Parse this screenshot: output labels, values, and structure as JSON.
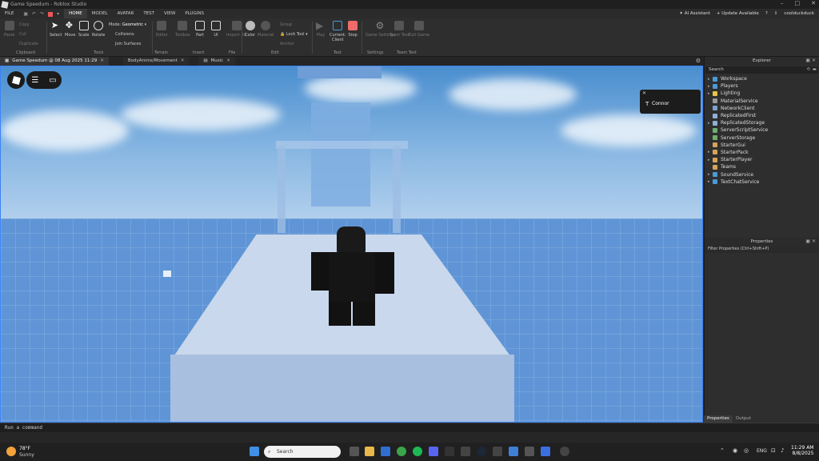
{
  "window": {
    "title": "Game Speedum - Roblox Studio"
  },
  "menu": {
    "items": [
      "FILE",
      "HOME",
      "MODEL",
      "AVATAR",
      "TEST",
      "VIEW",
      "PLUGINS"
    ],
    "ai_assistant": "AI Assistant",
    "update": "Update Available",
    "username": "coolduckduck"
  },
  "ribbon": {
    "clipboard": {
      "paste": "Paste",
      "copy": "Copy",
      "cut": "Cut",
      "duplicate": "Duplicate",
      "group": "Clipboard"
    },
    "tools": {
      "select": "Select",
      "move": "Move",
      "scale": "Scale",
      "rotate": "Rotate",
      "mode_label": "Mode:",
      "mode_value": "Geometric",
      "collisions": "Collisions",
      "join": "Join Surfaces",
      "group": "Tools"
    },
    "terrain": {
      "editor": "Editor",
      "toolbox": "Toolbox",
      "group": "Terrain"
    },
    "insert": {
      "part": "Part",
      "ui": "UI",
      "group": "Insert"
    },
    "file": {
      "import": "Import 3D",
      "group": "File"
    },
    "edit": {
      "color": "Color",
      "material": "Material",
      "group_btn": "Group",
      "lock": "Lock Tool",
      "anchor": "Anchor",
      "group": "Edit"
    },
    "test": {
      "play": "Play",
      "current": "Current:",
      "client": "Client",
      "stop": "Stop",
      "group": "Test"
    },
    "settings": {
      "game_settings": "Game Settings",
      "group": "Settings"
    },
    "team_test": {
      "team": "Team Test",
      "exit": "Exit Game",
      "group": "Team Test"
    }
  },
  "tabs": [
    {
      "label": "Game Speedum @ 08 Aug 2025 11:29"
    },
    {
      "label": "BodyAnims/Movement"
    },
    {
      "label": "Music"
    }
  ],
  "viewport": {
    "player_card": {
      "name": "Connor"
    }
  },
  "explorer": {
    "title": "Explorer",
    "search_placeholder": "Search",
    "items": [
      {
        "label": "Workspace",
        "icon_color": "#4a9ad6",
        "expand": true
      },
      {
        "label": "Players",
        "icon_color": "#4a9ad6",
        "expand": true
      },
      {
        "label": "Lighting",
        "icon_color": "#e8c24a",
        "expand": true
      },
      {
        "label": "MaterialService",
        "icon_color": "#999999",
        "expand": false
      },
      {
        "label": "NetworkClient",
        "icon_color": "#7aa0c8",
        "expand": false
      },
      {
        "label": "ReplicatedFirst",
        "icon_color": "#8fb0d8",
        "expand": false
      },
      {
        "label": "ReplicatedStorage",
        "icon_color": "#8fb0d8",
        "expand": true
      },
      {
        "label": "ServerScriptService",
        "icon_color": "#6fae6f",
        "expand": false
      },
      {
        "label": "ServerStorage",
        "icon_color": "#6fae6f",
        "expand": false
      },
      {
        "label": "StarterGui",
        "icon_color": "#d6a35a",
        "expand": false
      },
      {
        "label": "StarterPack",
        "icon_color": "#d6a35a",
        "expand": true
      },
      {
        "label": "StarterPlayer",
        "icon_color": "#d6a35a",
        "expand": true
      },
      {
        "label": "Teams",
        "icon_color": "#d6a35a",
        "expand": false
      },
      {
        "label": "SoundService",
        "icon_color": "#4a9ad6",
        "expand": true
      },
      {
        "label": "TextChatService",
        "icon_color": "#4a9ad6",
        "expand": true
      }
    ]
  },
  "properties": {
    "title": "Properties",
    "filter": "Filter Properties (Ctrl+Shift+P)"
  },
  "bottom_tabs": {
    "properties": "Properties",
    "output": "Output"
  },
  "command": {
    "placeholder": "Run a command"
  },
  "taskbar": {
    "weather_temp": "78°F",
    "weather_desc": "Sunny",
    "search": "Search",
    "lang": "ENG",
    "time": "11:29 AM",
    "date": "8/8/2025"
  }
}
